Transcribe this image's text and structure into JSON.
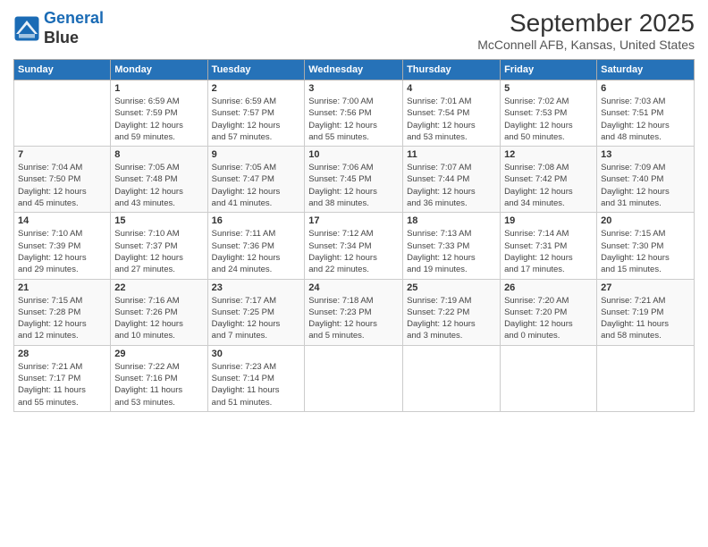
{
  "header": {
    "logo_line1": "General",
    "logo_line2": "Blue",
    "title": "September 2025",
    "subtitle": "McConnell AFB, Kansas, United States"
  },
  "columns": [
    "Sunday",
    "Monday",
    "Tuesday",
    "Wednesday",
    "Thursday",
    "Friday",
    "Saturday"
  ],
  "weeks": [
    [
      {
        "num": "",
        "info": ""
      },
      {
        "num": "1",
        "info": "Sunrise: 6:59 AM\nSunset: 7:59 PM\nDaylight: 12 hours\nand 59 minutes."
      },
      {
        "num": "2",
        "info": "Sunrise: 6:59 AM\nSunset: 7:57 PM\nDaylight: 12 hours\nand 57 minutes."
      },
      {
        "num": "3",
        "info": "Sunrise: 7:00 AM\nSunset: 7:56 PM\nDaylight: 12 hours\nand 55 minutes."
      },
      {
        "num": "4",
        "info": "Sunrise: 7:01 AM\nSunset: 7:54 PM\nDaylight: 12 hours\nand 53 minutes."
      },
      {
        "num": "5",
        "info": "Sunrise: 7:02 AM\nSunset: 7:53 PM\nDaylight: 12 hours\nand 50 minutes."
      },
      {
        "num": "6",
        "info": "Sunrise: 7:03 AM\nSunset: 7:51 PM\nDaylight: 12 hours\nand 48 minutes."
      }
    ],
    [
      {
        "num": "7",
        "info": "Sunrise: 7:04 AM\nSunset: 7:50 PM\nDaylight: 12 hours\nand 45 minutes."
      },
      {
        "num": "8",
        "info": "Sunrise: 7:05 AM\nSunset: 7:48 PM\nDaylight: 12 hours\nand 43 minutes."
      },
      {
        "num": "9",
        "info": "Sunrise: 7:05 AM\nSunset: 7:47 PM\nDaylight: 12 hours\nand 41 minutes."
      },
      {
        "num": "10",
        "info": "Sunrise: 7:06 AM\nSunset: 7:45 PM\nDaylight: 12 hours\nand 38 minutes."
      },
      {
        "num": "11",
        "info": "Sunrise: 7:07 AM\nSunset: 7:44 PM\nDaylight: 12 hours\nand 36 minutes."
      },
      {
        "num": "12",
        "info": "Sunrise: 7:08 AM\nSunset: 7:42 PM\nDaylight: 12 hours\nand 34 minutes."
      },
      {
        "num": "13",
        "info": "Sunrise: 7:09 AM\nSunset: 7:40 PM\nDaylight: 12 hours\nand 31 minutes."
      }
    ],
    [
      {
        "num": "14",
        "info": "Sunrise: 7:10 AM\nSunset: 7:39 PM\nDaylight: 12 hours\nand 29 minutes."
      },
      {
        "num": "15",
        "info": "Sunrise: 7:10 AM\nSunset: 7:37 PM\nDaylight: 12 hours\nand 27 minutes."
      },
      {
        "num": "16",
        "info": "Sunrise: 7:11 AM\nSunset: 7:36 PM\nDaylight: 12 hours\nand 24 minutes."
      },
      {
        "num": "17",
        "info": "Sunrise: 7:12 AM\nSunset: 7:34 PM\nDaylight: 12 hours\nand 22 minutes."
      },
      {
        "num": "18",
        "info": "Sunrise: 7:13 AM\nSunset: 7:33 PM\nDaylight: 12 hours\nand 19 minutes."
      },
      {
        "num": "19",
        "info": "Sunrise: 7:14 AM\nSunset: 7:31 PM\nDaylight: 12 hours\nand 17 minutes."
      },
      {
        "num": "20",
        "info": "Sunrise: 7:15 AM\nSunset: 7:30 PM\nDaylight: 12 hours\nand 15 minutes."
      }
    ],
    [
      {
        "num": "21",
        "info": "Sunrise: 7:15 AM\nSunset: 7:28 PM\nDaylight: 12 hours\nand 12 minutes."
      },
      {
        "num": "22",
        "info": "Sunrise: 7:16 AM\nSunset: 7:26 PM\nDaylight: 12 hours\nand 10 minutes."
      },
      {
        "num": "23",
        "info": "Sunrise: 7:17 AM\nSunset: 7:25 PM\nDaylight: 12 hours\nand 7 minutes."
      },
      {
        "num": "24",
        "info": "Sunrise: 7:18 AM\nSunset: 7:23 PM\nDaylight: 12 hours\nand 5 minutes."
      },
      {
        "num": "25",
        "info": "Sunrise: 7:19 AM\nSunset: 7:22 PM\nDaylight: 12 hours\nand 3 minutes."
      },
      {
        "num": "26",
        "info": "Sunrise: 7:20 AM\nSunset: 7:20 PM\nDaylight: 12 hours\nand 0 minutes."
      },
      {
        "num": "27",
        "info": "Sunrise: 7:21 AM\nSunset: 7:19 PM\nDaylight: 11 hours\nand 58 minutes."
      }
    ],
    [
      {
        "num": "28",
        "info": "Sunrise: 7:21 AM\nSunset: 7:17 PM\nDaylight: 11 hours\nand 55 minutes."
      },
      {
        "num": "29",
        "info": "Sunrise: 7:22 AM\nSunset: 7:16 PM\nDaylight: 11 hours\nand 53 minutes."
      },
      {
        "num": "30",
        "info": "Sunrise: 7:23 AM\nSunset: 7:14 PM\nDaylight: 11 hours\nand 51 minutes."
      },
      {
        "num": "",
        "info": ""
      },
      {
        "num": "",
        "info": ""
      },
      {
        "num": "",
        "info": ""
      },
      {
        "num": "",
        "info": ""
      }
    ]
  ]
}
